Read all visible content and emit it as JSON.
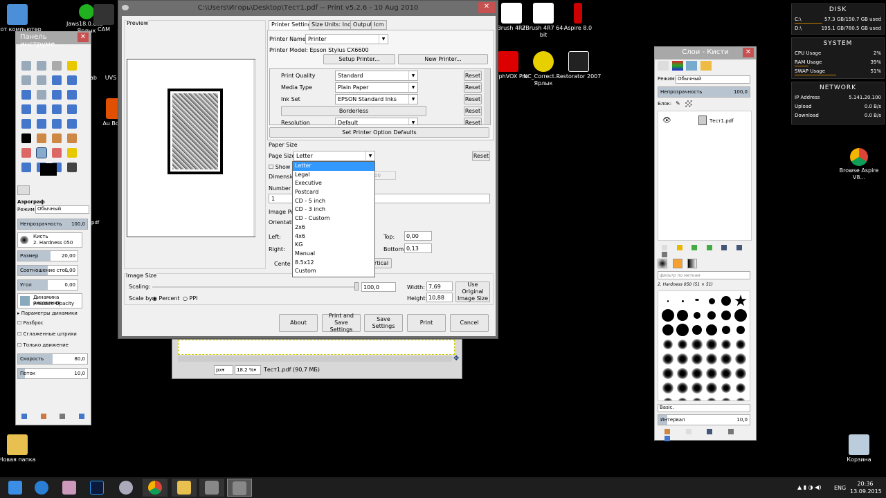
{
  "desktop": {
    "icons": [
      {
        "label": "Этот компьютер"
      },
      {
        "label": "Jaws18.0.exe - Ярлык"
      },
      {
        "label": "CAM"
      },
      {
        "label": "Brush 4R7"
      },
      {
        "label": "ZBrush 4R7 64-bit"
      },
      {
        "label": "Aspire 8.0"
      },
      {
        "label": "MorphVOX Pro"
      },
      {
        "label": "NC_Correct... - Ярлык"
      },
      {
        "label": "Restorator 2007"
      },
      {
        "label": "Browse Aspire V8..."
      },
      {
        "label": "Новая папка"
      },
      {
        "label": "Корзина"
      },
      {
        "label": "UVS"
      },
      {
        "label": "ab"
      },
      {
        "label": "Au Boo"
      }
    ]
  },
  "toolbox": {
    "title": "Панель инструме...",
    "tool_name": "Аэрограф",
    "mode_label": "Режим:",
    "mode_value": "Обычный",
    "opacity_label": "Непрозрачность",
    "opacity_value": "100,0",
    "brush_label": "Кисть",
    "brush_value": "2. Hardness 050",
    "size_label": "Размер",
    "size_value": "20,00",
    "ratio_label": "Соотношение сто...",
    "ratio_value": "0,00",
    "angle_label": "Угол",
    "angle_value": "0,00",
    "dynamics_label": "Динамика рисования",
    "dynamics_value": "Pressure Opacity",
    "dynamics_params": "Параметры динамики",
    "check1": "Разброс",
    "check2": "Сглаженные штрихи",
    "check3": "Только движение",
    "rate_label": "Скорость",
    "rate_value": "80,0",
    "flow_label": "Поток",
    "flow_value": "10,0",
    "partial": "pdf"
  },
  "print_dialog": {
    "title": "C:\\Users\\Игорь\\Desktop\\Тест1.pdf -- Print v5.2.6 - 10 Aug 2010",
    "preview_label": "Preview",
    "tabs": [
      "Printer Settings",
      "Size Units: Inch",
      "Output",
      "Icm"
    ],
    "printer_name_label": "Printer Name:",
    "printer_name_value": "Printer",
    "printer_model": "Printer Model: Epson Stylus CX6600",
    "setup_printer": "Setup Printer...",
    "new_printer": "New Printer...",
    "options": [
      {
        "label": "Print Quality",
        "value": "Standard",
        "reset": "Reset"
      },
      {
        "label": "Media Type",
        "value": "Plain Paper",
        "reset": "Reset"
      },
      {
        "label": "Ink Set",
        "value": "EPSON Standard Inks",
        "reset": "Reset"
      },
      {
        "label": "",
        "value": "Borderless",
        "reset": "Reset"
      },
      {
        "label": "Resolution",
        "value": "Default",
        "reset": "Reset"
      }
    ],
    "set_defaults": "Set Printer Option Defaults",
    "paper_size_group": "Paper Size",
    "page_size_label": "Page Size",
    "page_size_value": "Letter",
    "page_reset": "Reset",
    "show_label": "Show",
    "dimensions_label": "Dimensio",
    "dimensions_partial": "00",
    "number_label": "Number o",
    "number_value": "1",
    "image_position_label": "Image Po",
    "orientation_label": "Orientatio",
    "left_label": "Left:",
    "right_label": "Right:",
    "top_label": "Top:",
    "top_value": "0,00",
    "bottom_label": "Bottom:",
    "bottom_value": "0,13",
    "center_label": "Cente",
    "vertical_label": "rtical",
    "page_sizes": [
      "Letter",
      "Legal",
      "Executive",
      "Postcard",
      "CD - 5 inch",
      "CD - 3 inch",
      "CD - Custom",
      "2x6",
      "4x6",
      "KG",
      "Manual",
      "8.5x12",
      "Custom"
    ],
    "image_size_group": "Image Size",
    "scaling_label": "Scaling:",
    "scaling_value": "100,0",
    "scale_by_label": "Scale by:",
    "percent_label": "Percent",
    "ppi_label": "PPI",
    "width_label": "Width:",
    "width_value": "7,69",
    "height_label": "Height:",
    "height_value": "10,88",
    "use_original": "Use Original Image Size",
    "btn_about": "About",
    "btn_print_save": "Print and Save Settings",
    "btn_save": "Save Settings",
    "btn_print": "Print",
    "btn_cancel": "Cancel"
  },
  "gimp_canvas": {
    "unit": "px",
    "zoom": "18.2 %",
    "status": "Тест1.pdf (90,7 МБ)"
  },
  "layers_panel": {
    "title": "Слои - Кисти",
    "mode_label": "Режим:",
    "mode_value": "Обычный",
    "opacity_label": "Непрозрачность",
    "opacity_value": "100,0",
    "lock_label": "Блок:",
    "layer_name": "Тест1.pdf",
    "filter_placeholder": "фильтр по меткам",
    "brush_name": "2. Hardness 050 (51 × 51)",
    "preset_value": "Basic.",
    "spacing_label": "Интервал",
    "spacing_value": "10,0"
  },
  "widgets": {
    "disk_title": "DISK",
    "disks": [
      {
        "name": "C:\\",
        "value": "57.3 GB/150.7 GB used"
      },
      {
        "name": "D:\\",
        "value": "195.1 GB/780.5 GB used"
      }
    ],
    "system_title": "SYSTEM",
    "system": [
      {
        "name": "CPU Usage",
        "value": "2%"
      },
      {
        "name": "RAM Usage",
        "value": "39%"
      },
      {
        "name": "SWAP Usage",
        "value": "51%"
      }
    ],
    "network_title": "NETWORK",
    "network": [
      {
        "name": "IP Address",
        "value": "5.141.20.100"
      },
      {
        "name": "Upload",
        "value": "0.0 B/s"
      },
      {
        "name": "Download",
        "value": "0.0 B/s"
      }
    ]
  },
  "taskbar": {
    "language": "ENG",
    "time": "20:36",
    "date": "13.09.2015"
  }
}
